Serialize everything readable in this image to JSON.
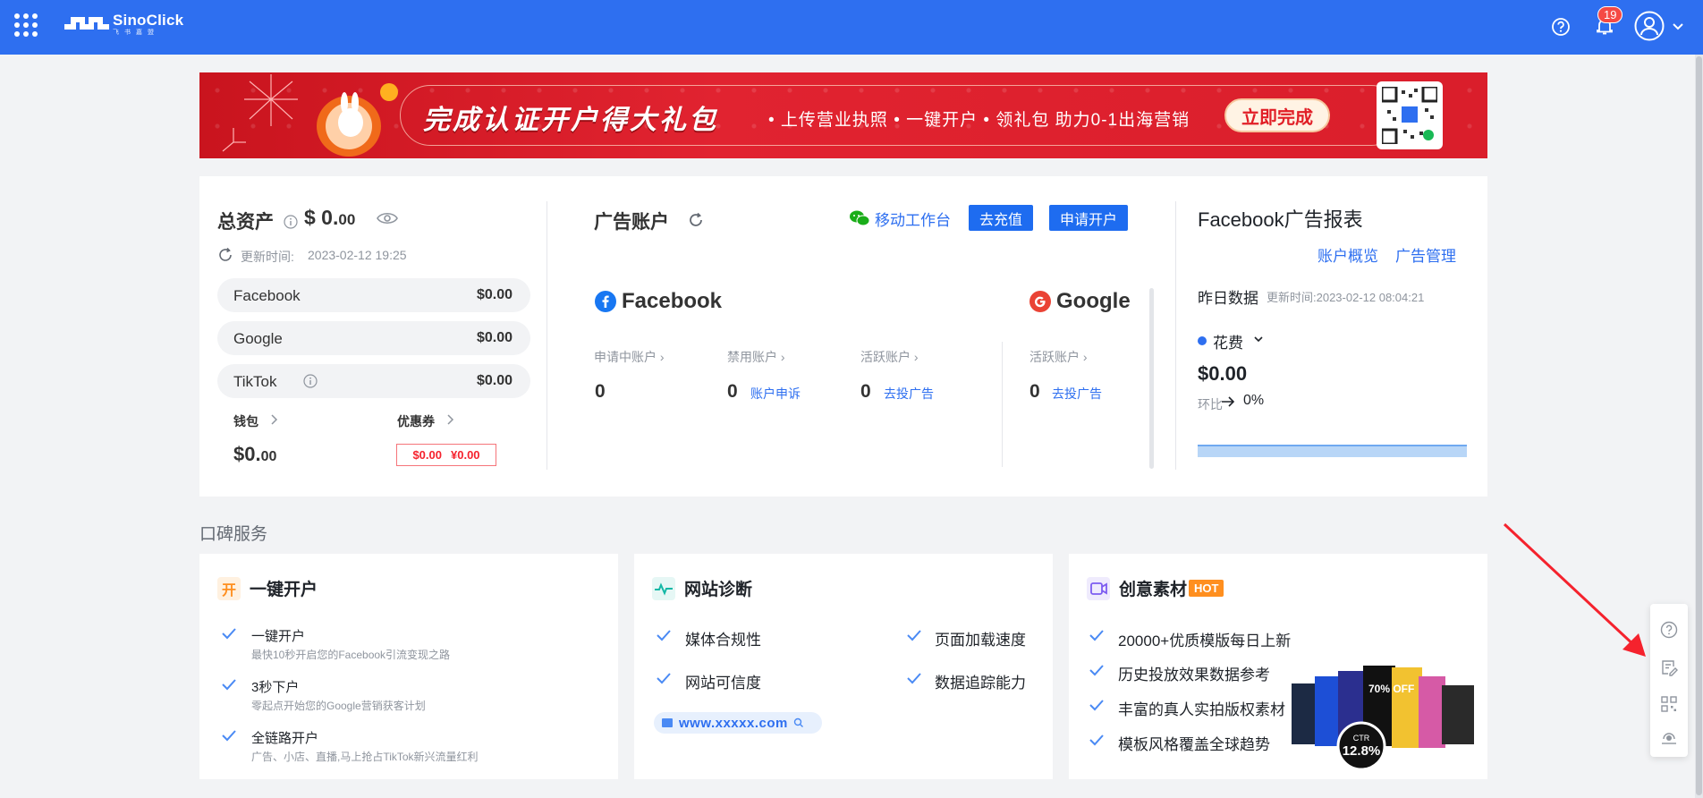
{
  "topbar": {
    "logo_text": "SinoClick",
    "logo_sub": "飞书嘉盟",
    "notification_count": "19"
  },
  "banner": {
    "title": "完成认证开户得大礼包",
    "subtitle": "• 上传营业执照 • 一键开户 • 领礼包 助力0-1出海营销",
    "cta": "立即完成"
  },
  "assets": {
    "title": "总资产",
    "value_main": "$ 0.",
    "value_dec": "00",
    "update_label": "更新时间:",
    "update_time": "2023-02-12 19:25",
    "platforms": [
      {
        "name": "Facebook",
        "amount": "$0.00"
      },
      {
        "name": "Google",
        "amount": "$0.00"
      },
      {
        "name": "TikTok",
        "amount": "$0.00"
      }
    ],
    "wallet_label": "钱包",
    "wallet_main": "$0.",
    "wallet_dec": "00",
    "coupon_label": "优惠券",
    "coupon_usd": "$0.00",
    "coupon_cny": "¥0.00"
  },
  "ad_accounts": {
    "title": "广告账户",
    "wechat_link": "移动工作台",
    "recharge_btn": "去充值",
    "apply_btn": "申请开户",
    "facebook": {
      "name": "Facebook",
      "stats": [
        {
          "label": "申请中账户",
          "value": "0",
          "link": ""
        },
        {
          "label": "禁用账户",
          "value": "0",
          "link": "账户申诉"
        },
        {
          "label": "活跃账户",
          "value": "0",
          "link": "去投广告"
        }
      ]
    },
    "google": {
      "name": "Google",
      "stats": [
        {
          "label": "活跃账户",
          "value": "0",
          "link": "去投广告"
        }
      ]
    }
  },
  "fb_report": {
    "title": "Facebook广告报表",
    "link_overview": "账户概览",
    "link_manage": "广告管理",
    "yesterday_label": "昨日数据",
    "update_time": "更新时间:2023-02-12 08:04:21",
    "metric_label": "花费",
    "metric_value": "$0.00",
    "compare_label": "环比",
    "compare_value": "0%"
  },
  "services": {
    "section_title": "口碑服务",
    "open_account": {
      "title": "一键开户",
      "icon_char": "开",
      "items": [
        {
          "title": "一键开户",
          "desc": "最快10秒开启您的Facebook引流变现之路"
        },
        {
          "title": "3秒下户",
          "desc": "零起点开始您的Google营销获客计划"
        },
        {
          "title": "全链路开户",
          "desc": "广告、小店、直播,马上抢占TikTok新兴流量红利"
        }
      ]
    },
    "site_diagnosis": {
      "title": "网站诊断",
      "features": [
        "媒体合规性",
        "页面加载速度",
        "网站可信度",
        "数据追踪能力"
      ],
      "url_text": "www.xxxxx.com"
    },
    "creative": {
      "title": "创意素材",
      "hot": "HOT",
      "features": [
        "20000+优质模版每日上新",
        "历史投放效果数据参考",
        "丰富的真人实拍版权素材",
        "模板风格覆盖全球趋势"
      ],
      "ctr_label": "CTR",
      "ctr_value": "12.8%",
      "promo_text": "70% OFF"
    }
  },
  "colors": {
    "primary": "#2e6ff0",
    "banner_red": "#d81e2a",
    "danger": "#f5222d",
    "hot": "#ff8f1f"
  }
}
